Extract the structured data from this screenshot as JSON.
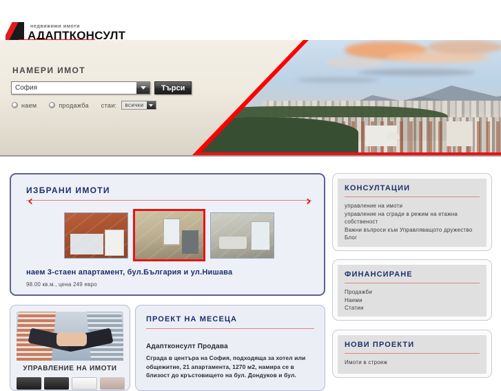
{
  "brand": {
    "tagline": "недвижими имоти",
    "name": "АДАПТКОНСУЛТ"
  },
  "search": {
    "title": "НАМЕРИ ИМОТ",
    "location_value": "София",
    "submit_label": "Търси",
    "rent_label": "наем",
    "sale_label": "продажба",
    "rooms_label": "стаи:",
    "rooms_value": "всички"
  },
  "featured": {
    "heading": "ИЗБРАНИ ИМОТИ",
    "prev_icon": "chevron-left-icon",
    "next_icon": "chevron-right-icon",
    "title": "наем 3-стаен апартамент, бул.България и ул.Нишава",
    "meta": "98.00 кв.м., цена 249 евро",
    "thumbs": [
      {
        "alt": "кухня с червени стени"
      },
      {
        "alt": "дневна с балконска врата"
      },
      {
        "alt": "кухня с прозорец"
      }
    ]
  },
  "promo": {
    "title": "УПРАВЛЕНИЕ НА ИМОТИ",
    "image_alt": "ръкостискане пред сгради"
  },
  "project": {
    "heading": "ПРОЕКТ НА МЕСЕЦА",
    "subtitle": "Адаптконсулт Продава",
    "body": "Сграда в центъра на София, подходяща за хотел или общежитие, 21 апартамента, 1270 м2, намира се в близост до кръстовището на бул. Дондуков и бул."
  },
  "sidebar": {
    "panels": [
      {
        "heading": "КОНСУЛТАЦИИ",
        "items": [
          "управление на имоти",
          "управление на сгради в режим на етажна собственост",
          "Важни въпроси към Управляващото дружество",
          "Блог"
        ]
      },
      {
        "heading": "ФИНАНСИРАНЕ",
        "items": [
          "Продажби",
          "Наеми",
          "Статии"
        ]
      },
      {
        "heading": "НОВИ ПРОЕКТИ",
        "items": [
          "Имоти в строеж"
        ]
      }
    ]
  },
  "colors": {
    "accent_red": "#e21b1b",
    "heading_navy": "#1b2f6e",
    "panel_border": "#5b5f96",
    "rule": "#e2827f"
  }
}
